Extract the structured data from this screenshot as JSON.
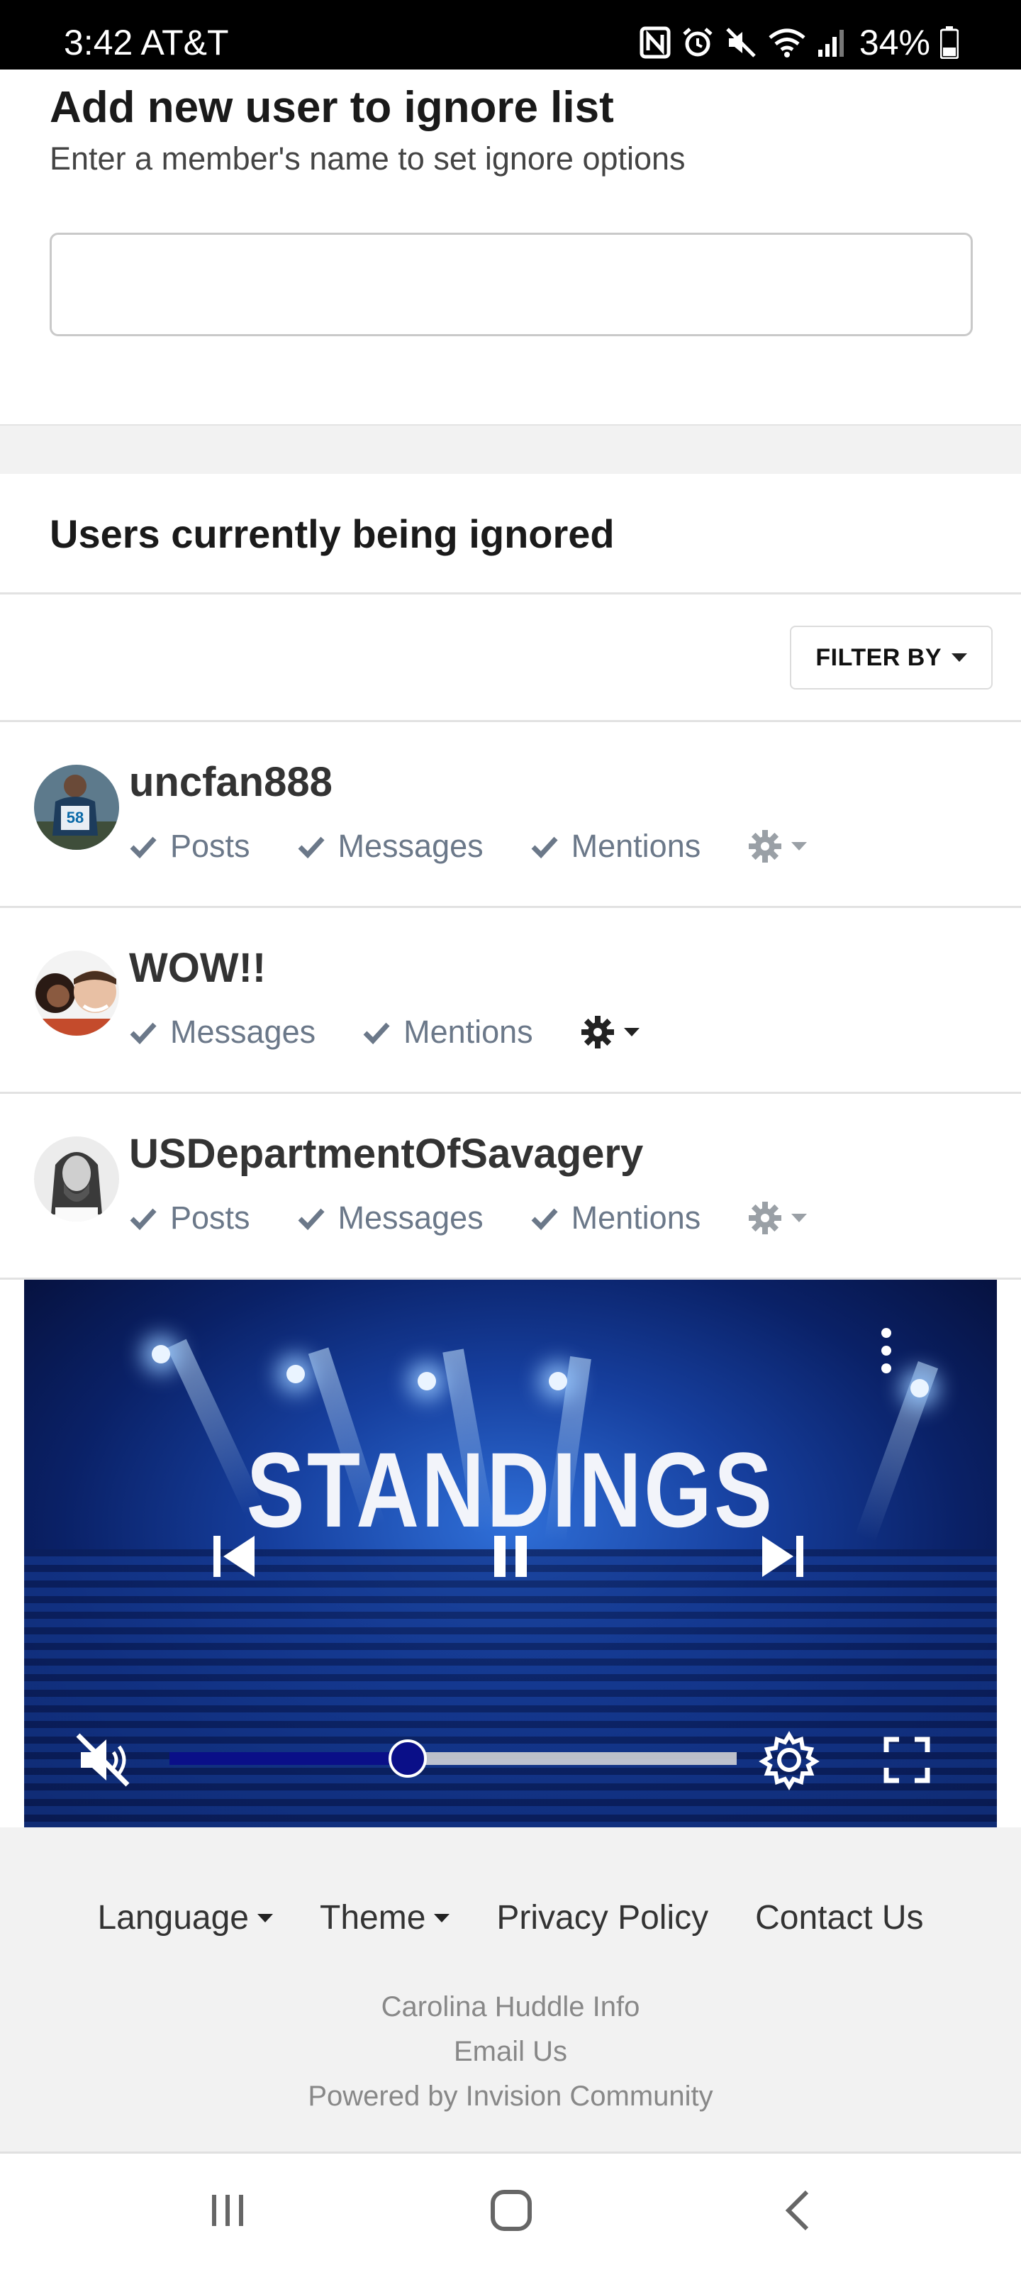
{
  "status_bar": {
    "time": "3:42 AT&T",
    "battery": "34%",
    "icons": [
      "nfc-icon",
      "alarm-icon",
      "mute-icon",
      "wifi-icon",
      "signal-icon",
      "battery-icon"
    ]
  },
  "add_user": {
    "title": "Add new user to ignore list",
    "subtitle": "Enter a member's name to set ignore options",
    "input_value": ""
  },
  "ignored": {
    "title": "Users currently being ignored",
    "filter_label": "FILTER BY",
    "users": [
      {
        "name": "uncfan888",
        "options": [
          "Posts",
          "Messages",
          "Mentions"
        ],
        "avatar_color": "#2a6fa8",
        "gear_state": "muted"
      },
      {
        "name": "WOW!!",
        "options": [
          "Messages",
          "Mentions"
        ],
        "avatar_color": "#e9b89a",
        "gear_state": "active"
      },
      {
        "name": "USDepartmentOfSavagery",
        "options": [
          "Posts",
          "Messages",
          "Mentions"
        ],
        "avatar_color": "#d8d8d8",
        "gear_state": "muted"
      }
    ]
  },
  "video": {
    "title_text": "STANDINGS",
    "progress": 0.42,
    "muted": true
  },
  "footer": {
    "language": "Language",
    "theme": "Theme",
    "privacy": "Privacy Policy",
    "contact": "Contact Us",
    "site_info": "Carolina Huddle Info",
    "email": "Email Us",
    "powered": "Powered by Invision Community"
  },
  "colors": {
    "option_text": "#6b7889",
    "accent_progress": "#0a0f88"
  }
}
